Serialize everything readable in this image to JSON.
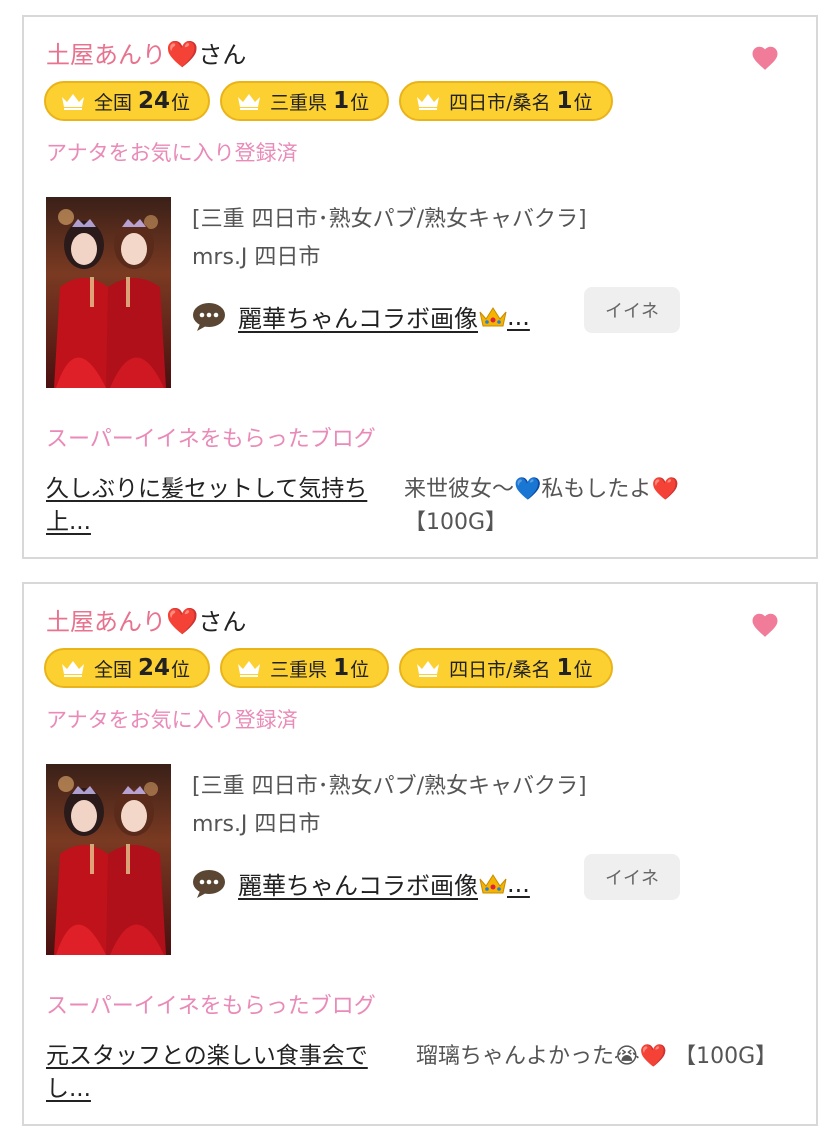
{
  "cards": [
    {
      "user_name": "土屋あんり",
      "heart_emoji": "❤️",
      "honorific": "さん",
      "badges": [
        {
          "label": "全国",
          "rank": "24",
          "unit": "位"
        },
        {
          "label": "三重県",
          "rank": "1",
          "unit": "位"
        },
        {
          "label": "四日市/桑名",
          "rank": "1",
          "unit": "位"
        }
      ],
      "favorite_status": "アナタをお気に入り登録済",
      "shop_category": "[三重 四日市･熟女パブ/熟女キャバクラ]",
      "shop_name": "mrs.J 四日市",
      "post_title": "麗華ちゃんコラボ画像",
      "post_ellipsis": "...",
      "iine_label": "イイネ",
      "super_heading": "スーパーイイネをもらったブログ",
      "blog_title": "久しぶりに髪セットして気持ち上...",
      "comment_text_1": "来世彼女〜",
      "comment_emoji_1": "💙",
      "comment_text_2": "私もしたよ",
      "comment_emoji_2": "❤️",
      "comment_suffix": "【100G】"
    },
    {
      "user_name": "土屋あんり",
      "heart_emoji": "❤️",
      "honorific": "さん",
      "badges": [
        {
          "label": "全国",
          "rank": "24",
          "unit": "位"
        },
        {
          "label": "三重県",
          "rank": "1",
          "unit": "位"
        },
        {
          "label": "四日市/桑名",
          "rank": "1",
          "unit": "位"
        }
      ],
      "favorite_status": "アナタをお気に入り登録済",
      "shop_category": "[三重 四日市･熟女パブ/熟女キャバクラ]",
      "shop_name": "mrs.J 四日市",
      "post_title": "麗華ちゃんコラボ画像",
      "post_ellipsis": "...",
      "iine_label": "イイネ",
      "super_heading": "スーパーイイネをもらったブログ",
      "blog_title": "元スタッフとの楽しい食事会でし...",
      "comment_text_1": "瑠璃ちゃんよかった",
      "comment_emoji_1": "😭",
      "comment_text_2": "",
      "comment_emoji_2": "❤️",
      "comment_suffix": "【100G】"
    }
  ],
  "colors": {
    "name_pink": "#e8738f",
    "favorite_pink": "#e98ab8",
    "badge_yellow": "#fdd031",
    "fav_heart": "#f07c9a"
  }
}
